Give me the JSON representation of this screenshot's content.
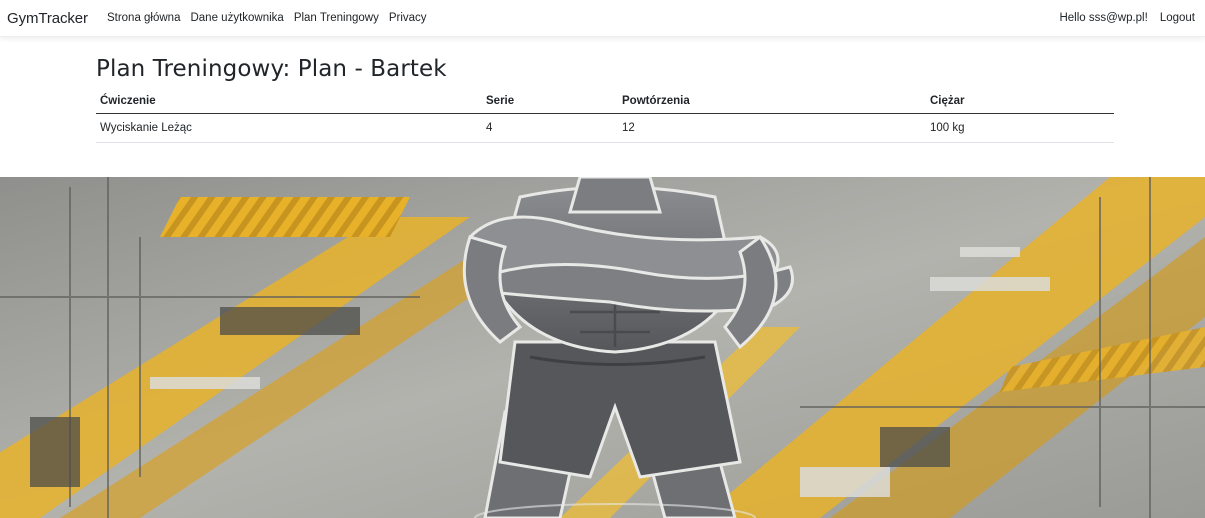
{
  "navbar": {
    "brand": "GymTracker",
    "links": [
      "Strona główna",
      "Dane użytkownika",
      "Plan Treningowy",
      "Privacy"
    ],
    "greeting": "Hello sss@wp.pl!",
    "logout": "Logout"
  },
  "page": {
    "title": "Plan Treningowy: Plan - Bartek"
  },
  "table": {
    "headers": [
      "Ćwiczenie",
      "Serie",
      "Powtórzenia",
      "Ciężar"
    ],
    "rows": [
      [
        "Wyciskanie Leżąc",
        "4",
        "12",
        "100 kg"
      ]
    ]
  },
  "colors": {
    "accent_yellow": "#e8b12a",
    "background_gray": "#a7a7a3",
    "figure_gray": "#6d6f73"
  }
}
